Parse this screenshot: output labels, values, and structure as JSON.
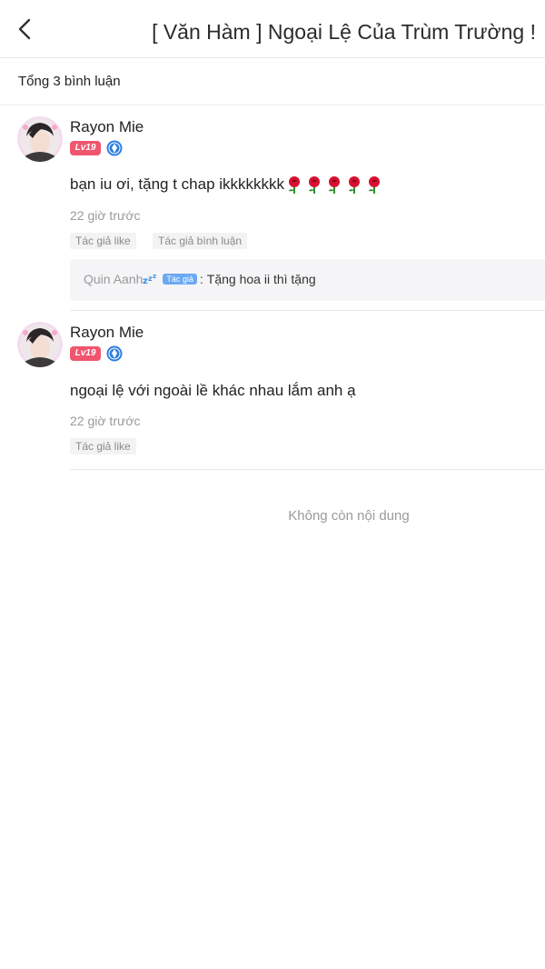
{
  "header": {
    "back_icon": "chevron-left-icon",
    "title": "[ Văn Hàm ] Ngoại Lệ Của Trùm Trường !"
  },
  "summary": {
    "total_label": "Tổng 3 bình luận"
  },
  "comments": [
    {
      "username": "Rayon Mie",
      "level": "Lv19",
      "verify_icon": "verified-diamond-icon",
      "text": "bạn iu ơi, tặng t chap ikkkkkkkk",
      "emoji_icon": "rose-icon",
      "emoji_count": 5,
      "time": "22 giờ trước",
      "tags": [
        "Tác giả like",
        "Tác giả bình luận"
      ],
      "reply": {
        "author": "Quin Aanh",
        "author_icon": "zzz-icon",
        "author_badge": "Tác giả",
        "colon": ":",
        "text": "Tặng hoa ii thì tặng"
      }
    },
    {
      "username": "Rayon Mie",
      "level": "Lv19",
      "verify_icon": "verified-diamond-icon",
      "text": "ngoại lệ với ngoài lề khác nhau lắm anh ạ",
      "time": "22 giờ trước",
      "tags": [
        "Tác giả like"
      ]
    }
  ],
  "footer": {
    "end_text": "Không còn nội dung"
  },
  "colors": {
    "level_badge": "#f0566e",
    "verify_badge": "#2f7fe0",
    "author_badge": "#6aa9f4",
    "rose": "#d8102f"
  }
}
